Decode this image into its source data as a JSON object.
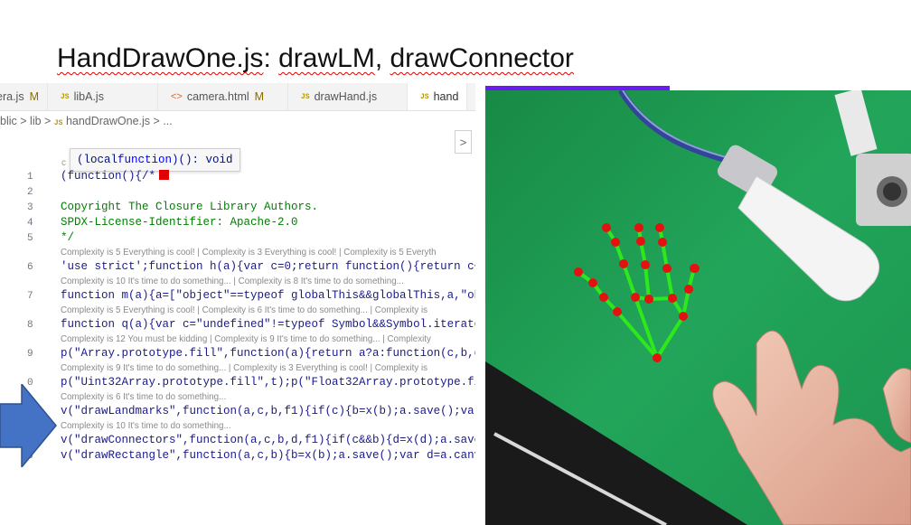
{
  "slide": {
    "title_parts": [
      "HandDrawOne.js",
      ": ",
      "drawLM",
      ", ",
      "drawConnector"
    ]
  },
  "tabs": [
    {
      "label": "era.js",
      "badge": "M",
      "icon": "none"
    },
    {
      "label": "libA.js",
      "badge": "",
      "icon": "JS"
    },
    {
      "label": "camera.html",
      "badge": "M",
      "icon": "<>"
    },
    {
      "label": "drawHand.js",
      "badge": "",
      "icon": "JS"
    },
    {
      "label": "hand",
      "badge": "",
      "icon": "JS"
    }
  ],
  "breadcrumb": {
    "part1": "blic",
    "sep": ">",
    "part2": "lib",
    "file": "handDrawOne.js",
    "ellipsis": "..."
  },
  "hover_tooltip": {
    "prefix": "(local ",
    "keyword": "function",
    "suffix": ")(): void"
  },
  "partial_c": "c",
  "collapse_label": ">",
  "code_lines": [
    {
      "num": "1",
      "text": "(function(){/*",
      "style": "dark",
      "redsq": true
    },
    {
      "num": "2",
      "text": "",
      "style": "comment"
    },
    {
      "num": "3",
      "text": " Copyright The Closure Library Authors.",
      "style": "comment"
    },
    {
      "num": "4",
      "text": " SPDX-License-Identifier: Apache-2.0",
      "style": "comment"
    },
    {
      "num": "5",
      "text": "*/",
      "style": "comment"
    },
    {
      "hint": "Complexity is 5 Everything is cool! | Complexity is 3 Everything is cool! | Complexity is 5 Everyth"
    },
    {
      "num": "6",
      "text": "'use strict';function h(a){var c=0;return function(){return c<a.l",
      "style": "dark"
    },
    {
      "hint": "Complexity is 10 It's time to do something... | Complexity is 8 It's time to do something..."
    },
    {
      "num": "7",
      "text": "function m(a){a=[\"object\"==typeof globalThis&&globalThis,a,\"objec",
      "style": "dark"
    },
    {
      "hint": "Complexity is 5 Everything is cool! | Complexity is 6 It's time to do something... | Complexity is"
    },
    {
      "num": "8",
      "text": "function q(a){var c=\"undefined\"!=typeof Symbol&&Symbol.iterator&&",
      "style": "dark"
    },
    {
      "hint": "Complexity is 12 You must be kidding | Complexity is 9 It's time to do something... | Complexity"
    },
    {
      "num": "9",
      "text": "p(\"Array.prototype.fill\",function(a){return a?a:function(c,b,d){v",
      "style": "dark"
    },
    {
      "hint": "Complexity is 9 It's time to do something... | Complexity is 3 Everything is cool! | Complexity is"
    },
    {
      "num": "0",
      "text": "p(\"Uint32Array.prototype.fill\",t);p(\"Float32Array.prototype.fill\"",
      "style": "dark"
    },
    {
      "hint": "Complexity is 6 It's time to do something..."
    },
    {
      "num": "",
      "text": "v(\"drawLandmarks\",function(a,c,b,f1){if(c){b=x(b);a.save();var d=",
      "style": "dark"
    },
    {
      "hint": "Complexity is 10 It's time to do something..."
    },
    {
      "num": "",
      "text": "v(\"drawConnectors\",function(a,c,b,d,f1){if(c&&b){d=x(d);a.save();",
      "style": "dark"
    },
    {
      "num": "3",
      "text": "v(\"drawRectangle\",function(a,c,b){b=x(b);a.save();var d=a.canvas;",
      "style": "dark"
    }
  ],
  "colors": {
    "landmark": "#e41111",
    "connector": "#2ee81c",
    "mat": "#1f9e55",
    "arrow": "#4472c4",
    "purple": "#6a1cf0"
  },
  "icons": [
    "right-arrow-icon",
    "js-file-icon",
    "html-file-icon"
  ]
}
